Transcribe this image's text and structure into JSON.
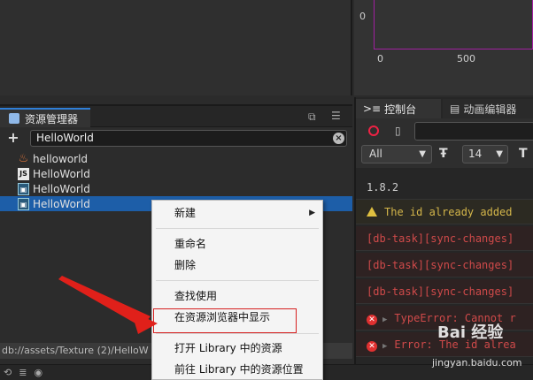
{
  "timeline": {
    "y_tick": "0",
    "x_ticks": [
      "0",
      "500"
    ]
  },
  "assets_panel": {
    "tab_label": "资源管理器",
    "search_value": "HelloWorld",
    "items": [
      {
        "label": "helloworld",
        "icon": "fire-icon"
      },
      {
        "label": "HelloWorld",
        "icon": "js-file-icon"
      },
      {
        "label": "HelloWorld",
        "icon": "scene-file-icon"
      },
      {
        "label": "HelloWorld",
        "icon": "scene-file-icon",
        "selected": true
      }
    ],
    "status_path": "db://assets/Texture (2)/HelloW"
  },
  "console_panel": {
    "tab_console": "控制台",
    "tab_animation": "动画编辑器",
    "level_filter": "All",
    "font_size": "14",
    "logs": [
      {
        "type": "plain",
        "text": "1.8.2"
      },
      {
        "type": "warn",
        "text": "The id already added"
      },
      {
        "type": "err",
        "text": "[db-task][sync-changes]"
      },
      {
        "type": "err",
        "text": "[db-task][sync-changes]"
      },
      {
        "type": "err",
        "text": "[db-task][sync-changes]"
      },
      {
        "type": "err-expand",
        "text": "TypeError: Cannot r"
      },
      {
        "type": "err-expand",
        "text": "Error: The id alrea"
      }
    ]
  },
  "context_menu": {
    "items": {
      "new": "新建",
      "rename": "重命名",
      "delete": "删除",
      "find_usage": "查找使用",
      "show_in_browser": "在资源浏览器中显示",
      "open_library": "打开 Library 中的资源",
      "goto_library": "前往 Library 中的资源位置"
    }
  },
  "watermark": {
    "brand": "Bai 经验",
    "url": "jingyan.baidu.com"
  },
  "colors": {
    "selection": "#1d5ea8",
    "tab_accent": "#2f7fd8",
    "error": "#d04a4a",
    "warning": "#d4b64a",
    "highlight": "#d62020"
  }
}
